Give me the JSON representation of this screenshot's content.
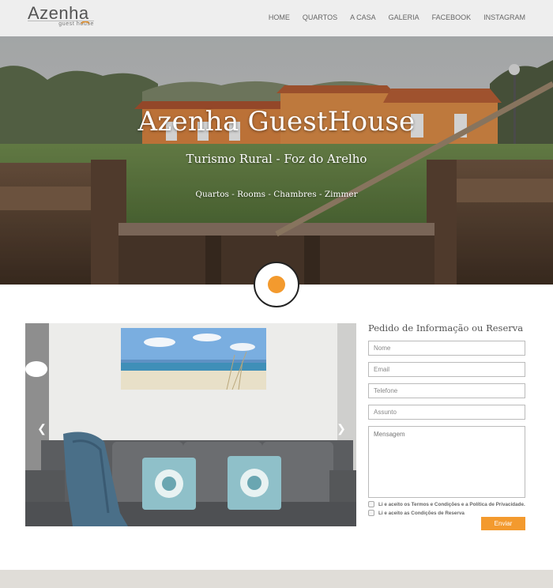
{
  "brand": {
    "name": "Azenha",
    "tagline": "guest house",
    "accent_color": "#f39a2e"
  },
  "nav": {
    "items": [
      {
        "label": "HOME"
      },
      {
        "label": "QUARTOS"
      },
      {
        "label": "A CASA"
      },
      {
        "label": "GALERIA"
      },
      {
        "label": "FACEBOOK"
      },
      {
        "label": "INSTAGRAM"
      }
    ]
  },
  "hero": {
    "title": "Azenha GuestHouse",
    "subtitle": "Turismo Rural - Foz do Arelho",
    "languages": "Quartos - Rooms - Chambres - Zimmer"
  },
  "gallery": {
    "prev_icon": "chevron-left-icon",
    "next_icon": "chevron-right-icon"
  },
  "form": {
    "title": "Pedido de Informação ou Reserva",
    "name_placeholder": "Nome",
    "email_placeholder": "Email",
    "phone_placeholder": "Telefone",
    "subject_placeholder": "Assunto",
    "message_placeholder": "Mensagem",
    "terms_label": "Li e aceito os Termos e Condições e a Política de Privacidade.",
    "booking_label": "Li e aceito as Condições de Reserva",
    "submit_label": "Enviar"
  }
}
